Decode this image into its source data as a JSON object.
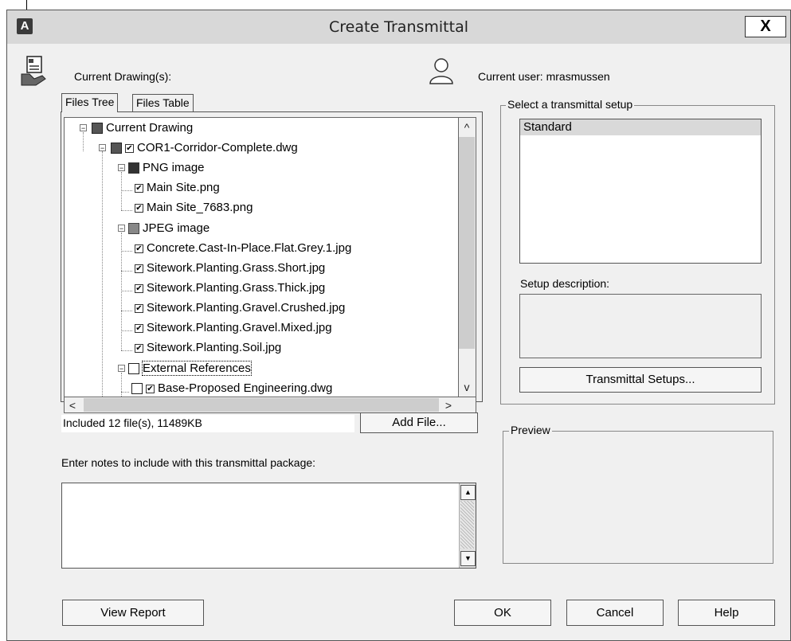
{
  "window": {
    "title": "Create Transmittal",
    "close_label": "X",
    "app_icon_letter": "A"
  },
  "header": {
    "current_drawings_label": "Current Drawing(s):",
    "current_user_label": "Current user: mrasmussen"
  },
  "tabs": [
    {
      "label": "Files Tree",
      "active": true
    },
    {
      "label": "Files Table",
      "active": false
    }
  ],
  "tree": {
    "root": "Current Drawing",
    "drawing": "COR1-Corridor-Complete.dwg",
    "png_group": "PNG image",
    "png_files": [
      "Main Site.png",
      "Main Site_7683.png"
    ],
    "jpeg_group": "JPEG image",
    "jpeg_files": [
      "Concrete.Cast-In-Place.Flat.Grey.1.jpg",
      "Sitework.Planting.Grass.Short.jpg",
      "Sitework.Planting.Grass.Thick.jpg",
      "Sitework.Planting.Gravel.Crushed.jpg",
      "Sitework.Planting.Gravel.Mixed.jpg",
      "Sitework.Planting.Soil.jpg"
    ],
    "xref_group": "External References",
    "xref_files": [
      "Base-Proposed Engineering.dwg"
    ]
  },
  "status": {
    "included": "Included 12 file(s), 11489KB",
    "add_file": "Add File..."
  },
  "notes": {
    "label": "Enter notes to include with this transmittal package:",
    "value": ""
  },
  "setup": {
    "group_title": "Select a transmittal setup",
    "items": [
      "Standard"
    ],
    "selected": "Standard",
    "description_label": "Setup description:",
    "description": "",
    "setups_button": "Transmittal Setups..."
  },
  "preview": {
    "group_title": "Preview"
  },
  "footer": {
    "view_report": "View Report",
    "ok": "OK",
    "cancel": "Cancel",
    "help": "Help"
  },
  "glyphs": {
    "check": "✔",
    "minus": "−",
    "up": "^",
    "down": "v",
    "left": "<",
    "right": ">",
    "up_tri": "▲",
    "down_tri": "▼"
  }
}
